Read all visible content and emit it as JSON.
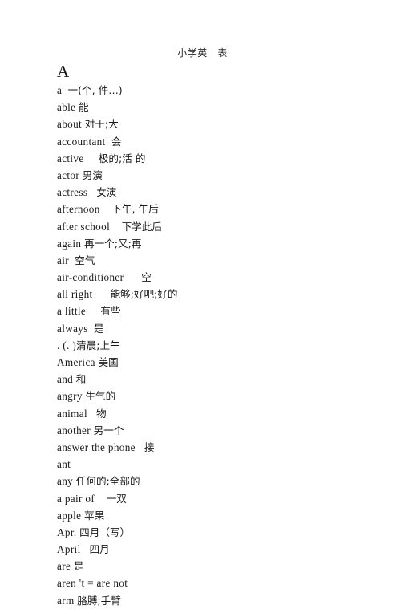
{
  "document": {
    "title": "小学英　表",
    "section_letter": "A",
    "background_color": "#ffffff",
    "text_color": "#1a1a1a"
  },
  "entries": [
    {
      "term": "a",
      "gap": "  ",
      "gloss": "一(个, 件…)"
    },
    {
      "term": "able",
      "gap": " ",
      "gloss": "能"
    },
    {
      "term": "about",
      "gap": " ",
      "gloss": "对于;大"
    },
    {
      "term": "accountant",
      "gap": "  ",
      "gloss": "会"
    },
    {
      "term": "active",
      "gap": "     ",
      "gloss": "极的;活 的"
    },
    {
      "term": "actor",
      "gap": " ",
      "gloss": "男演"
    },
    {
      "term": "actress",
      "gap": "   ",
      "gloss": "女演"
    },
    {
      "term": "afternoon",
      "gap": "    ",
      "gloss": "下午, 午后"
    },
    {
      "term": "after school",
      "gap": "    ",
      "gloss": "下学此后"
    },
    {
      "term": "again",
      "gap": " ",
      "gloss": "再一个;又;再"
    },
    {
      "term": "air",
      "gap": "  ",
      "gloss": "空气"
    },
    {
      "term": "air-conditioner",
      "gap": "      ",
      "gloss": "空"
    },
    {
      "term": "all right",
      "gap": "      ",
      "gloss": "能够;好吧;好的"
    },
    {
      "term": "a little",
      "gap": "     ",
      "gloss": "有些"
    },
    {
      "term": "always",
      "gap": "  ",
      "gloss": "是"
    },
    {
      "term": ". (. )",
      "gap": "",
      "gloss": "清晨;上午"
    },
    {
      "term": "America",
      "gap": " ",
      "gloss": "美国"
    },
    {
      "term": "and",
      "gap": " ",
      "gloss": "和"
    },
    {
      "term": "angry",
      "gap": " ",
      "gloss": "生气的"
    },
    {
      "term": "animal",
      "gap": "   ",
      "gloss": "物"
    },
    {
      "term": "another",
      "gap": " ",
      "gloss": "另一个"
    },
    {
      "term": "answer the phone",
      "gap": "   ",
      "gloss": "接"
    },
    {
      "term": "ant",
      "gap": "",
      "gloss": ""
    },
    {
      "term": "any",
      "gap": " ",
      "gloss": "任何的;全部的"
    },
    {
      "term": "a pair of",
      "gap": "    ",
      "gloss": "一双"
    },
    {
      "term": "apple",
      "gap": " ",
      "gloss": "苹果"
    },
    {
      "term": "Apr.",
      "gap": " ",
      "gloss": "四月（写）"
    },
    {
      "term": "April",
      "gap": "   ",
      "gloss": "四月"
    },
    {
      "term": "are",
      "gap": " ",
      "gloss": "是"
    },
    {
      "term": "aren 't = are not",
      "gap": "",
      "gloss": ""
    },
    {
      "term": "arm",
      "gap": " ",
      "gloss": "胳膊;手臂"
    }
  ]
}
